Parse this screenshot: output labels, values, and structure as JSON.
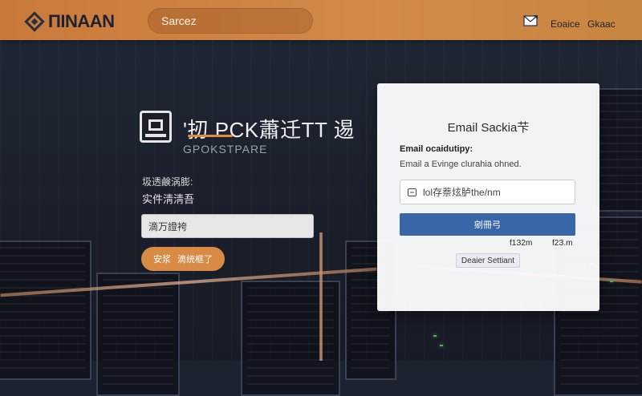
{
  "header": {
    "brand": "ΠINAAN",
    "search_placeholder": "Sarcez",
    "links": [
      "Eoaice",
      "Gkaac"
    ]
  },
  "hero": {
    "title": "'扨 PCK蕭迁TT 逷",
    "subtitle": "GPOKSTPARE",
    "label_small": "圾透鹸涡膨:",
    "label_main": "实件淸淸吾",
    "input_value": "滴万證袴",
    "button_label": "安浆",
    "button_label2": "滴统框了"
  },
  "card": {
    "title": "Email Sackia芐",
    "subheading": "Email ocaidutipy:",
    "description": "Email a Evinge clurahia ohned.",
    "input_placeholder": "lol存萘炫胪the/nm",
    "submit_label": "剜冊弓",
    "meta_left": "f1З2m",
    "meta_right": "f2З.m",
    "secondary_label": "Deaier Settiant"
  },
  "colors": {
    "header": "#d2894a",
    "accent_orange": "#d98b45",
    "primary_blue": "#3a66a8",
    "background": "#1d2230"
  },
  "icons": [
    "logo-icon",
    "search-field",
    "mail-icon",
    "app-icon",
    "email-icon"
  ]
}
